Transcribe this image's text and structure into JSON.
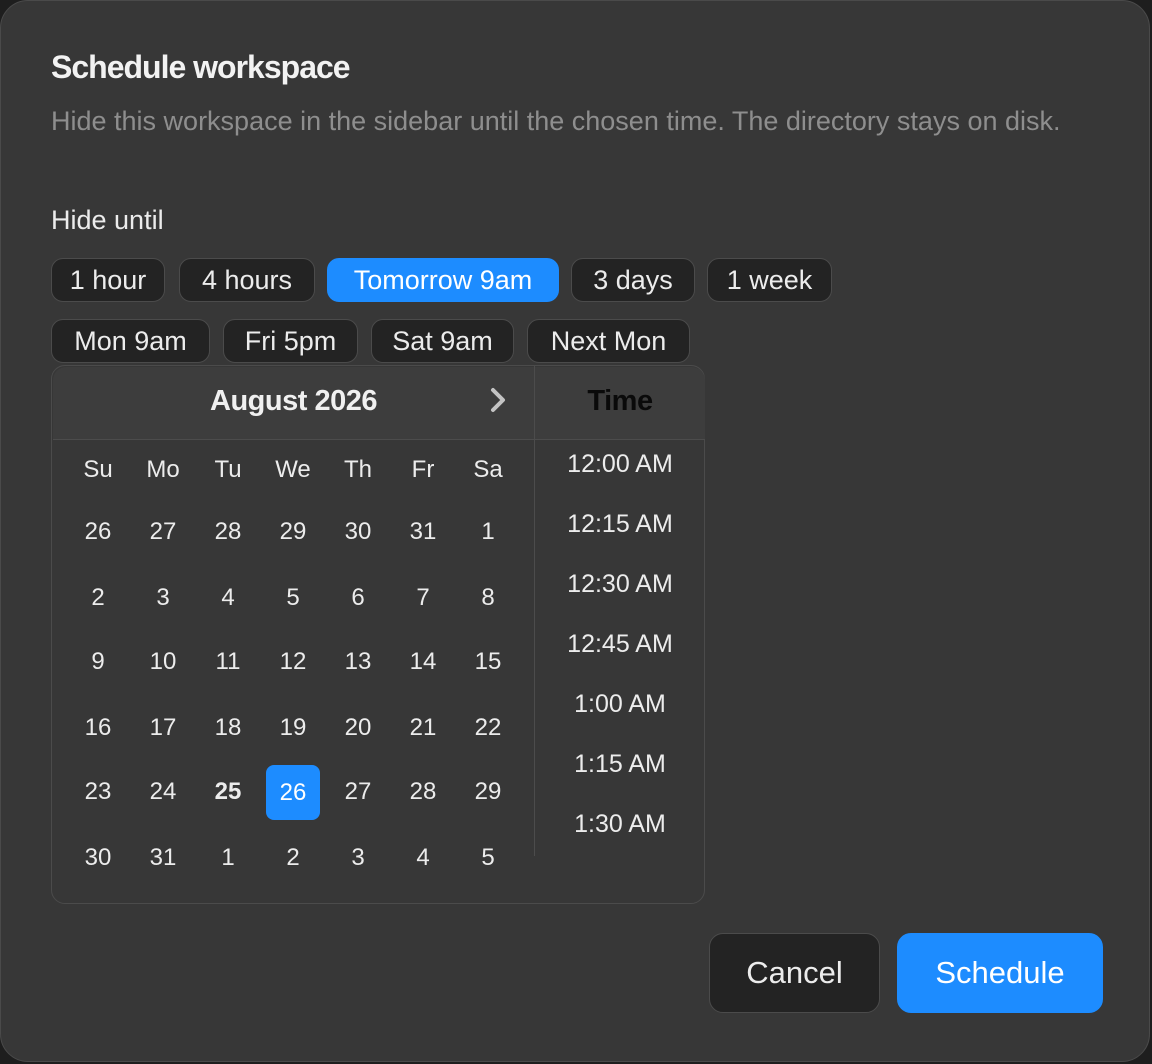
{
  "dialog": {
    "title": "Schedule workspace",
    "subtitle": "Hide this workspace in the sidebar until the chosen time. The directory stays on disk.",
    "hide_until_label": "Hide until"
  },
  "presets": [
    {
      "label": "1 hour",
      "selected": false
    },
    {
      "label": "4 hours",
      "selected": false
    },
    {
      "label": "Tomorrow 9am",
      "selected": true
    },
    {
      "label": "3 days",
      "selected": false
    },
    {
      "label": "1 week",
      "selected": false
    },
    {
      "label": "Mon 9am",
      "selected": false
    },
    {
      "label": "Fri 5pm",
      "selected": false
    },
    {
      "label": "Sat 9am",
      "selected": false
    },
    {
      "label": "Next Mon",
      "selected": false
    }
  ],
  "calendar": {
    "month_label": "August 2026",
    "next_icon": "chevron-right-icon",
    "weekdays": [
      "Su",
      "Mo",
      "Tu",
      "We",
      "Th",
      "Fr",
      "Sa"
    ],
    "weeks": [
      [
        "26",
        "27",
        "28",
        "29",
        "30",
        "31",
        "1"
      ],
      [
        "2",
        "3",
        "4",
        "5",
        "6",
        "7",
        "8"
      ],
      [
        "9",
        "10",
        "11",
        "12",
        "13",
        "14",
        "15"
      ],
      [
        "16",
        "17",
        "18",
        "19",
        "20",
        "21",
        "22"
      ],
      [
        "23",
        "24",
        "25",
        "26",
        "27",
        "28",
        "29"
      ],
      [
        "30",
        "31",
        "1",
        "2",
        "3",
        "4",
        "5"
      ]
    ],
    "today": "25",
    "selected": "26"
  },
  "time": {
    "title": "Time",
    "options": [
      "12:00 AM",
      "12:15 AM",
      "12:30 AM",
      "12:45 AM",
      "1:00 AM",
      "1:15 AM",
      "1:30 AM"
    ]
  },
  "actions": {
    "cancel_label": "Cancel",
    "schedule_label": "Schedule"
  },
  "colors": {
    "accent": "#1d8cff",
    "dialog_bg": "#373737",
    "chip_bg": "#232323"
  }
}
